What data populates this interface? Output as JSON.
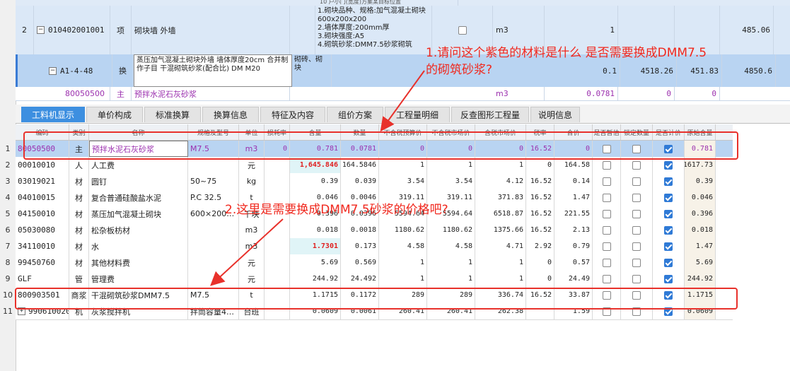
{
  "top_table": {
    "partial_row_text": "10 户小门(宽度)方案某目标位置",
    "row2": {
      "row_number": "2",
      "code": "010402001001",
      "type": "项",
      "name": "砌块墙 外墙",
      "features": "1.砌块品种、规格:加气混凝土砌块600x200x200\n2.墙体厚度:200mm厚\n3.砌块强度:A5\n4.砌筑砂浆:DMM7.5砂浆砌筑",
      "unit": "m3",
      "quantity": "1",
      "total": "485.06"
    },
    "row3": {
      "code": "A1-4-48",
      "type": "换",
      "name": "蒸压加气混凝土砌块外墙 墙体厚度20cm 合并制作子目 干混砌筑砂浆(配合比) DM M20",
      "category": "砌砖、砌块",
      "quantity": "0.1",
      "price": "4518.26",
      "amount": "451.83",
      "total": "4850.6"
    },
    "row4": {
      "code": "80050500",
      "type": "主",
      "name": "预拌水泥石灰砂浆",
      "unit": "m3",
      "quantity": "0.0781",
      "v1": "0",
      "v2": "0"
    }
  },
  "tabs": [
    "工料机显示",
    "单价构成",
    "标准换算",
    "换算信息",
    "特征及内容",
    "组价方案",
    "工程量明细",
    "反查图形工程量",
    "说明信息"
  ],
  "grid": {
    "headers": [
      "编码",
      "类别",
      "名称",
      "规格及型号",
      "单位",
      "损耗率",
      "含量",
      "数量",
      "不含税预算价",
      "不含税市场价",
      "含税市场价",
      "税率",
      "合价",
      "是否暂估",
      "锁定数量",
      "是否计价",
      "原始含量"
    ],
    "rows": [
      {
        "n": "1",
        "code": "80050500",
        "cat": "主",
        "name": "预拌水泥石灰砂浆",
        "spec": "M7.5",
        "unit": "m3",
        "loss": "0",
        "content": "0.781",
        "qty": "0.0781",
        "p1": "0",
        "p2": "0",
        "p3": "0",
        "tax": "16.52",
        "sum": "0",
        "est": false,
        "lock": false,
        "price": true,
        "orig": "0.781"
      },
      {
        "n": "2",
        "code": "00010010",
        "cat": "人",
        "name": "人工费",
        "spec": "",
        "unit": "元",
        "loss": "",
        "content": "1,645.846",
        "qty": "164.5846",
        "p1": "1",
        "p2": "1",
        "p3": "1",
        "tax": "0",
        "sum": "164.58",
        "est": false,
        "lock": false,
        "price": true,
        "orig": "1617.73"
      },
      {
        "n": "3",
        "code": "03019021",
        "cat": "材",
        "name": "圆钉",
        "spec": "50~75",
        "unit": "kg",
        "loss": "",
        "content": "0.39",
        "qty": "0.039",
        "p1": "3.54",
        "p2": "3.54",
        "p3": "4.12",
        "tax": "16.52",
        "sum": "0.14",
        "est": false,
        "lock": false,
        "price": true,
        "orig": "0.39"
      },
      {
        "n": "4",
        "code": "04010015",
        "cat": "材",
        "name": "复合普通硅酸盐水泥",
        "spec": "P.C 32.5",
        "unit": "t",
        "loss": "",
        "content": "0.046",
        "qty": "0.0046",
        "p1": "319.11",
        "p2": "319.11",
        "p3": "371.83",
        "tax": "16.52",
        "sum": "1.47",
        "est": false,
        "lock": false,
        "price": true,
        "orig": "0.046"
      },
      {
        "n": "5",
        "code": "04150010",
        "cat": "材",
        "name": "蒸压加气混凝土砌块",
        "spec": "600×200…",
        "unit": "千块",
        "loss": "",
        "content": "0.396",
        "qty": "0.0396",
        "p1": "5594.64",
        "p2": "5594.64",
        "p3": "6518.87",
        "tax": "16.52",
        "sum": "221.55",
        "est": false,
        "lock": false,
        "price": true,
        "orig": "0.396"
      },
      {
        "n": "6",
        "code": "05030080",
        "cat": "材",
        "name": "松杂板枋材",
        "spec": "",
        "unit": "m3",
        "loss": "",
        "content": "0.018",
        "qty": "0.0018",
        "p1": "1180.62",
        "p2": "1180.62",
        "p3": "1375.66",
        "tax": "16.52",
        "sum": "2.13",
        "est": false,
        "lock": false,
        "price": true,
        "orig": "0.018"
      },
      {
        "n": "7",
        "code": "34110010",
        "cat": "材",
        "name": "水",
        "spec": "",
        "unit": "m3",
        "loss": "",
        "content": "1.7301",
        "qty": "0.173",
        "p1": "4.58",
        "p2": "4.58",
        "p3": "4.71",
        "tax": "2.92",
        "sum": "0.79",
        "est": false,
        "lock": false,
        "price": true,
        "orig": "1.47"
      },
      {
        "n": "8",
        "code": "99450760",
        "cat": "材",
        "name": "其他材料费",
        "spec": "",
        "unit": "元",
        "loss": "",
        "content": "5.69",
        "qty": "0.569",
        "p1": "1",
        "p2": "1",
        "p3": "1",
        "tax": "0",
        "sum": "0.57",
        "est": false,
        "lock": false,
        "price": true,
        "orig": "5.69"
      },
      {
        "n": "9",
        "code": "GLF",
        "cat": "管",
        "name": "管理费",
        "spec": "",
        "unit": "元",
        "loss": "",
        "content": "244.92",
        "qty": "24.492",
        "p1": "1",
        "p2": "1",
        "p3": "1",
        "tax": "0",
        "sum": "24.49",
        "est": false,
        "lock": false,
        "price": true,
        "orig": "244.92"
      },
      {
        "n": "10",
        "code": "800903501",
        "cat": "商浆",
        "name": "干混砌筑砂浆DMM7.5",
        "spec": "M7.5",
        "unit": "t",
        "loss": "",
        "content": "1.1715",
        "qty": "0.1172",
        "p1": "289",
        "p2": "289",
        "p3": "336.74",
        "tax": "16.52",
        "sum": "33.87",
        "est": false,
        "lock": false,
        "price": true,
        "orig": "1.1715"
      },
      {
        "n": "11",
        "code": "990610020",
        "cat": "机",
        "name": "灰浆搅拌机",
        "spec": "拌筒容量4…",
        "unit": "台班",
        "loss": "",
        "content": "0.0609",
        "qty": "0.0061",
        "p1": "260.41",
        "p2": "260.41",
        "p3": "262.38",
        "tax": "",
        "sum": "1.59",
        "est": false,
        "lock": false,
        "price": true,
        "orig": "0.0609"
      }
    ]
  },
  "annotations": {
    "q1_line1": "1.请问这个紫色的材料是什么  是否需要换成DMM7.5",
    "q1_line2": "的砌筑砂浆?",
    "q2": "2.这里是需要换成DMM7.5砂浆的价格吧?"
  },
  "colors": {
    "selected_row": "#b9d4f2",
    "tab_active": "#3d8fe0",
    "annotation_red": "#e8312b",
    "purple_material": "#9b2fae",
    "red_value": "#e02020"
  }
}
